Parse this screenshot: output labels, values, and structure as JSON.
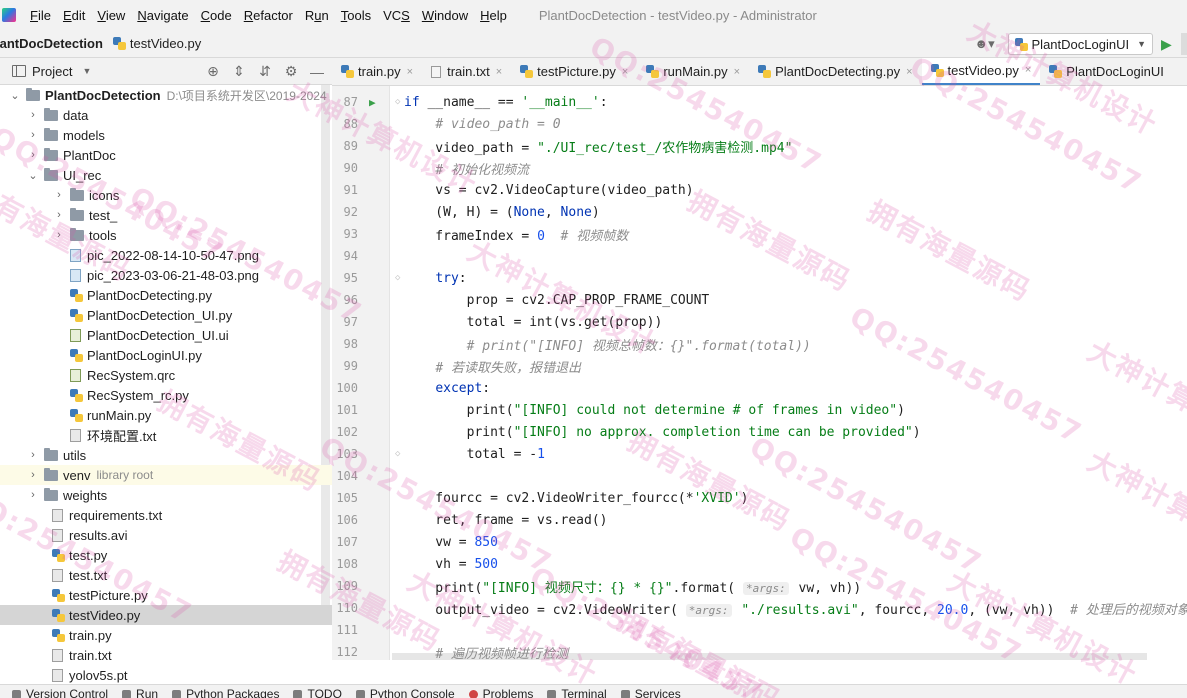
{
  "menu": {
    "items": [
      {
        "label": "File",
        "mnemonic": "F"
      },
      {
        "label": "Edit",
        "mnemonic": "E"
      },
      {
        "label": "View",
        "mnemonic": "V"
      },
      {
        "label": "Navigate",
        "mnemonic": "N"
      },
      {
        "label": "Code",
        "mnemonic": "C"
      },
      {
        "label": "Refactor",
        "mnemonic": "R"
      },
      {
        "label": "Run",
        "mnemonic": "u"
      },
      {
        "label": "Tools",
        "mnemonic": "T"
      },
      {
        "label": "VCS",
        "mnemonic": "S"
      },
      {
        "label": "Window",
        "mnemonic": "W"
      },
      {
        "label": "Help",
        "mnemonic": "H"
      }
    ],
    "window_title": "PlantDocDetection - testVideo.py - Administrator"
  },
  "nav": {
    "project": "lantDocDetection",
    "file": "testVideo.py",
    "run_config": "PlantDocLoginUI"
  },
  "project_panel": {
    "title": "Project",
    "tree": [
      {
        "label": "PlantDocDetection",
        "extra": "D:\\项目系统开发区\\2019-2024",
        "indent": 0,
        "type": "folder",
        "arrow": "open",
        "bold": true
      },
      {
        "label": "data",
        "indent": 1,
        "type": "folder",
        "arrow": "closed"
      },
      {
        "label": "models",
        "indent": 1,
        "type": "folder",
        "arrow": "closed"
      },
      {
        "label": "PlantDoc",
        "indent": 1,
        "type": "folder",
        "arrow": "closed"
      },
      {
        "label": "UI_rec",
        "indent": 1,
        "type": "folder",
        "arrow": "open"
      },
      {
        "label": "icons",
        "indent": 2,
        "type": "folder",
        "arrow": "closed"
      },
      {
        "label": "test_",
        "indent": 2,
        "type": "folder",
        "arrow": "closed"
      },
      {
        "label": "tools",
        "indent": 2,
        "type": "folder",
        "arrow": "closed"
      },
      {
        "label": "pic_2022-08-14-10-50-47.png",
        "indent": 3,
        "type": "img"
      },
      {
        "label": "pic_2023-03-06-21-48-03.png",
        "indent": 3,
        "type": "img"
      },
      {
        "label": "PlantDocDetecting.py",
        "indent": 3,
        "type": "py"
      },
      {
        "label": "PlantDocDetection_UI.py",
        "indent": 3,
        "type": "py"
      },
      {
        "label": "PlantDocDetection_UI.ui",
        "indent": 3,
        "type": "ui"
      },
      {
        "label": "PlantDocLoginUI.py",
        "indent": 3,
        "type": "py"
      },
      {
        "label": "RecSystem.qrc",
        "indent": 3,
        "type": "qrc"
      },
      {
        "label": "RecSystem_rc.py",
        "indent": 3,
        "type": "py"
      },
      {
        "label": "runMain.py",
        "indent": 3,
        "type": "py"
      },
      {
        "label": "环境配置.txt",
        "indent": 3,
        "type": "txt"
      },
      {
        "label": "utils",
        "indent": 1,
        "type": "folder",
        "arrow": "closed"
      },
      {
        "label": "venv",
        "extra": "library root",
        "indent": 1,
        "type": "folder",
        "arrow": "closed",
        "venv": true
      },
      {
        "label": "weights",
        "indent": 1,
        "type": "folder",
        "arrow": "closed"
      },
      {
        "label": "requirements.txt",
        "indent": 2,
        "type": "txt"
      },
      {
        "label": "results.avi",
        "indent": 2,
        "type": "txt"
      },
      {
        "label": "test.py",
        "indent": 2,
        "type": "py"
      },
      {
        "label": "test.txt",
        "indent": 2,
        "type": "txt"
      },
      {
        "label": "testPicture.py",
        "indent": 2,
        "type": "py"
      },
      {
        "label": "testVideo.py",
        "indent": 2,
        "type": "py",
        "selected": true
      },
      {
        "label": "train.py",
        "indent": 2,
        "type": "py"
      },
      {
        "label": "train.txt",
        "indent": 2,
        "type": "txt"
      },
      {
        "label": "yolov5s.pt",
        "indent": 2,
        "type": "txt"
      }
    ]
  },
  "tabs": [
    {
      "label": "train.py",
      "type": "py"
    },
    {
      "label": "train.txt",
      "type": "txt"
    },
    {
      "label": "testPicture.py",
      "type": "py"
    },
    {
      "label": "runMain.py",
      "type": "py"
    },
    {
      "label": "PlantDocDetecting.py",
      "type": "py"
    },
    {
      "label": "testVideo.py",
      "type": "py",
      "active": true
    },
    {
      "label": "PlantDocLoginUI",
      "type": "py"
    }
  ],
  "code_lines": [
    {
      "n": "87",
      "run": true,
      "fold": true,
      "tokens": [
        [
          "kw",
          "if"
        ],
        [
          "p",
          " __name__ == "
        ],
        [
          "str",
          "'__main__'"
        ],
        [
          "p",
          ":"
        ]
      ]
    },
    {
      "n": "88",
      "tokens": [
        [
          "p",
          "    "
        ],
        [
          "cmt",
          "# video_path = 0"
        ]
      ]
    },
    {
      "n": "89",
      "tokens": [
        [
          "p",
          "    video_path = "
        ],
        [
          "str",
          "\"./UI_rec/test_/农作物病害检测.mp4\""
        ]
      ]
    },
    {
      "n": "90",
      "tokens": [
        [
          "p",
          "    "
        ],
        [
          "cmt",
          "# 初始化视频流"
        ]
      ]
    },
    {
      "n": "91",
      "tokens": [
        [
          "p",
          "    vs = cv2.VideoCapture(video_path)"
        ]
      ]
    },
    {
      "n": "92",
      "tokens": [
        [
          "p",
          "    (W, H) = ("
        ],
        [
          "kw",
          "None"
        ],
        [
          "p",
          ", "
        ],
        [
          "kw",
          "None"
        ],
        [
          "p",
          ")"
        ]
      ]
    },
    {
      "n": "93",
      "tokens": [
        [
          "p",
          "    frameIndex = "
        ],
        [
          "num",
          "0"
        ],
        [
          "p",
          "  "
        ],
        [
          "cmt",
          "# 视频帧数"
        ]
      ]
    },
    {
      "n": "94",
      "tokens": []
    },
    {
      "n": "95",
      "fold": true,
      "tokens": [
        [
          "p",
          "    "
        ],
        [
          "kw",
          "try"
        ],
        [
          "p",
          ":"
        ]
      ]
    },
    {
      "n": "96",
      "tokens": [
        [
          "p",
          "        prop = cv2.CAP_PROP_FRAME_COUNT"
        ]
      ]
    },
    {
      "n": "97",
      "tokens": [
        [
          "p",
          "        total = int(vs.get(prop))"
        ]
      ]
    },
    {
      "n": "98",
      "tokens": [
        [
          "p",
          "        "
        ],
        [
          "cmt",
          "# print(\"[INFO] 视频总帧数：{}\".format(total))"
        ]
      ]
    },
    {
      "n": "99",
      "tokens": [
        [
          "p",
          "    "
        ],
        [
          "cmt",
          "# 若读取失败，报错退出"
        ]
      ]
    },
    {
      "n": "100",
      "tokens": [
        [
          "p",
          "    "
        ],
        [
          "kw",
          "except"
        ],
        [
          "p",
          ":"
        ]
      ]
    },
    {
      "n": "101",
      "tokens": [
        [
          "p",
          "        print("
        ],
        [
          "str",
          "\"[INFO] could not determine # of frames in video\""
        ],
        [
          "p",
          ")"
        ]
      ]
    },
    {
      "n": "102",
      "tokens": [
        [
          "p",
          "        print("
        ],
        [
          "str",
          "\"[INFO] no approx. completion time can be provided\""
        ],
        [
          "p",
          ")"
        ]
      ]
    },
    {
      "n": "103",
      "fold": true,
      "tokens": [
        [
          "p",
          "        total = -"
        ],
        [
          "num",
          "1"
        ]
      ]
    },
    {
      "n": "104",
      "tokens": []
    },
    {
      "n": "105",
      "tokens": [
        [
          "p",
          "    fourcc = cv2.VideoWriter_fourcc(*"
        ],
        [
          "str",
          "'XVID'"
        ],
        [
          "p",
          ")"
        ]
      ]
    },
    {
      "n": "106",
      "tokens": [
        [
          "p",
          "    ret, frame = vs.read()"
        ]
      ]
    },
    {
      "n": "107",
      "tokens": [
        [
          "p",
          "    vw = "
        ],
        [
          "num",
          "850"
        ]
      ]
    },
    {
      "n": "108",
      "tokens": [
        [
          "p",
          "    vh = "
        ],
        [
          "num",
          "500"
        ]
      ]
    },
    {
      "n": "109",
      "tokens": [
        [
          "p",
          "    print("
        ],
        [
          "str",
          "\"[INFO] 视频尺寸：{} * {}\""
        ],
        [
          "p",
          ".format( "
        ],
        [
          "hint",
          "*args:"
        ],
        [
          "p",
          " vw, vh))"
        ]
      ]
    },
    {
      "n": "110",
      "tokens": [
        [
          "p",
          "    output_video = cv2.VideoWriter( "
        ],
        [
          "hint",
          "*args:"
        ],
        [
          "str",
          " \"./results.avi\""
        ],
        [
          "p",
          ", fourcc, "
        ],
        [
          "num",
          "20.0"
        ],
        [
          "p",
          ", (vw, vh))  "
        ],
        [
          "cmt",
          "# 处理后的视频对象"
        ]
      ]
    },
    {
      "n": "111",
      "tokens": []
    },
    {
      "n": "112",
      "tokens": [
        [
          "p",
          "    "
        ],
        [
          "cmt",
          "# 遍历视频帧进行检测"
        ]
      ]
    }
  ],
  "bottom_tools": [
    {
      "label": "Version Control",
      "icon": "branch-icon"
    },
    {
      "label": "Run",
      "icon": "run-icon"
    },
    {
      "label": "Python Packages",
      "icon": "packages-icon"
    },
    {
      "label": "TODO",
      "icon": "todo-icon"
    },
    {
      "label": "Python Console",
      "icon": "console-icon"
    },
    {
      "label": "Problems",
      "icon": "problems-icon"
    },
    {
      "label": "Terminal",
      "icon": "terminal-icon"
    },
    {
      "label": "Services",
      "icon": "services-icon"
    }
  ],
  "watermark_texts": [
    "QQ:254540457",
    "拥有海量源码",
    "大神计算机设计"
  ],
  "colors": {
    "keyword": "#0033b3",
    "string": "#067d17",
    "number": "#1750eb",
    "comment": "#8c8c8c",
    "watermark": "#dc50aa",
    "accent": "#4083c9"
  }
}
